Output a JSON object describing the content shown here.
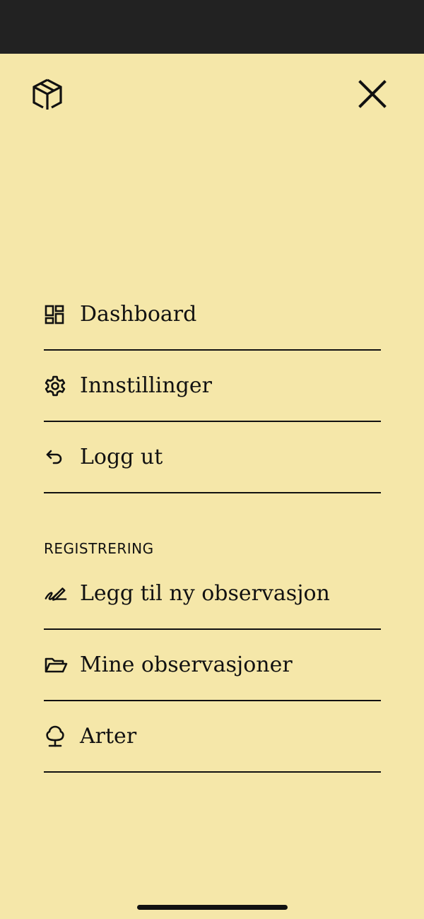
{
  "header": {
    "logo_icon": "cube-logo-icon",
    "close_icon": "close-icon"
  },
  "menu": {
    "items": [
      {
        "label": "Dashboard",
        "icon": "dashboard-icon"
      },
      {
        "label": "Innstillinger",
        "icon": "gear-icon"
      },
      {
        "label": "Logg ut",
        "icon": "undo-arrow-icon"
      }
    ]
  },
  "registrering": {
    "section_label": "REGISTRERING",
    "items": [
      {
        "label": "Legg til ny observasjon",
        "icon": "pen-scribble-icon"
      },
      {
        "label": "Mine observasjoner",
        "icon": "folder-open-icon"
      },
      {
        "label": "Arter",
        "icon": "tree-icon"
      }
    ]
  },
  "colors": {
    "background": "#F5E7A9",
    "status_bar": "#222222",
    "text": "#111111"
  }
}
